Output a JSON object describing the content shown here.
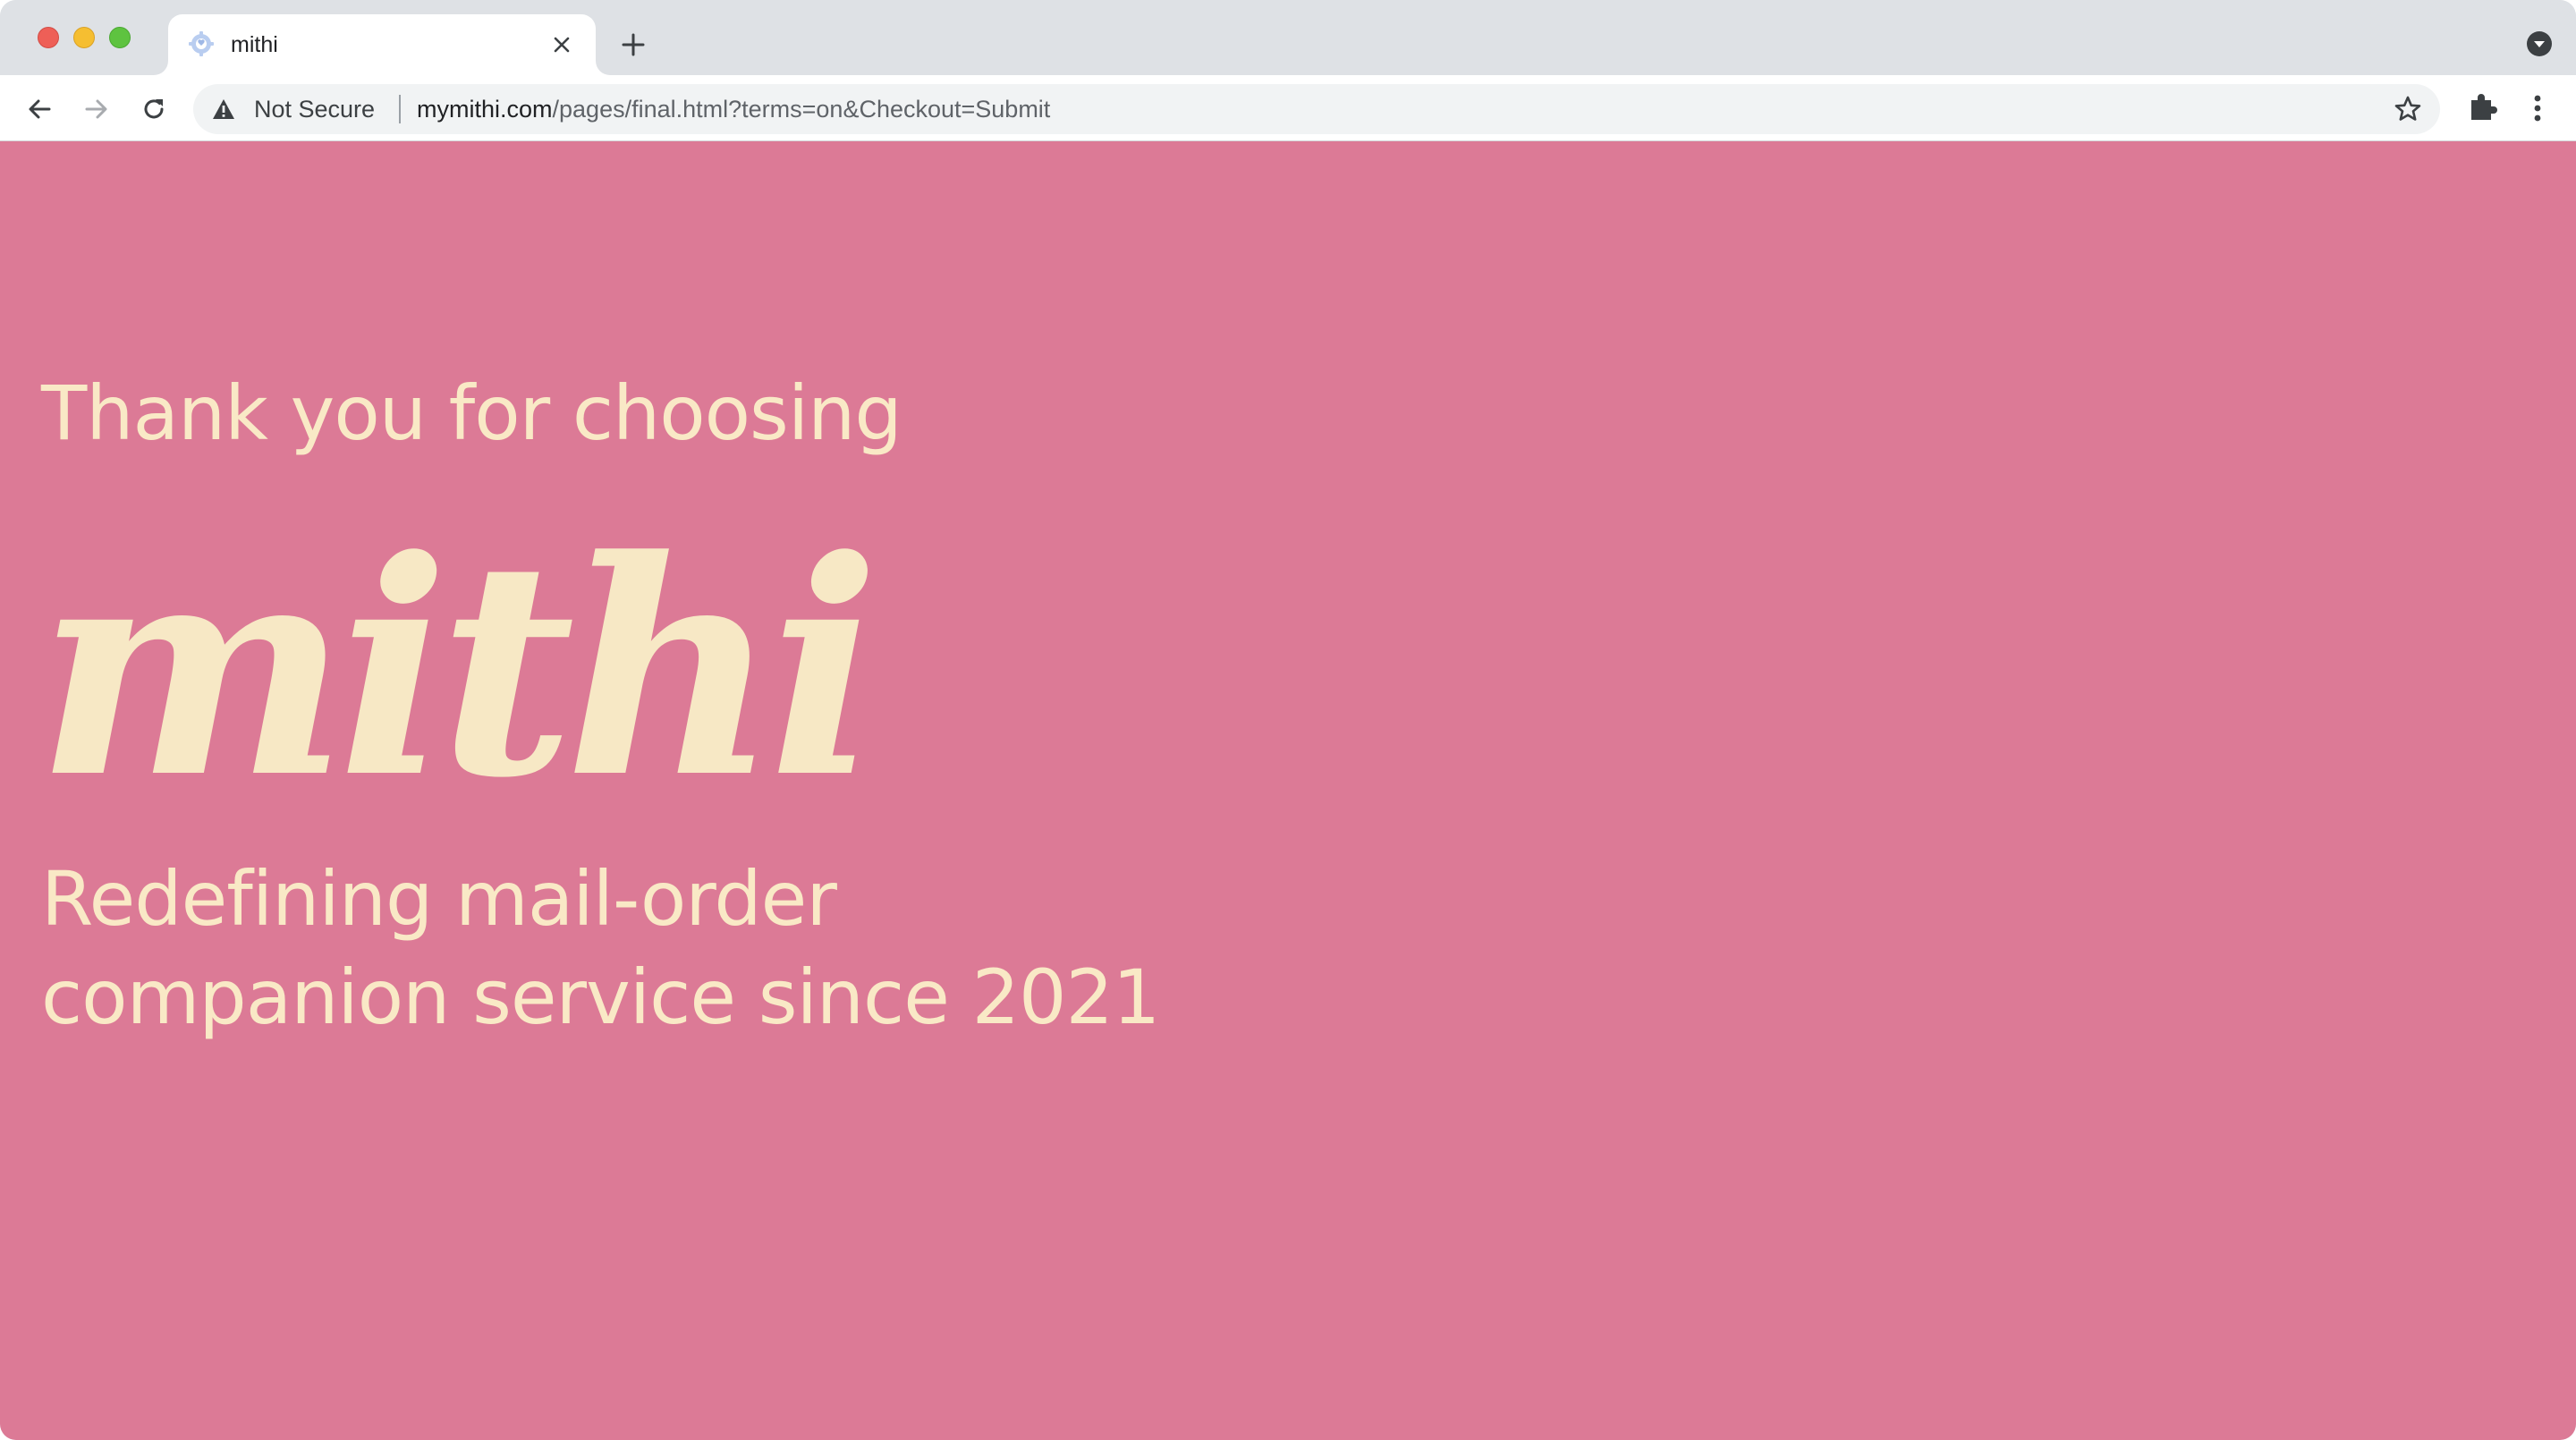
{
  "browser": {
    "tab": {
      "title": "mithi",
      "favicon": "gear-icon"
    },
    "omnibox": {
      "security_label": "Not Secure",
      "url_host": "mymithi.com",
      "url_path": "/pages/final.html?terms=on&Checkout=Submit"
    },
    "icons": {
      "back": "arrow-left-icon",
      "forward": "arrow-right-icon",
      "reload": "reload-icon",
      "warning": "warning-icon",
      "bookmark": "star-icon",
      "extensions": "puzzle-icon",
      "menu": "kebab-menu-icon",
      "new_tab": "plus-icon",
      "close_tab": "close-icon",
      "tab_search": "chevron-down-icon"
    }
  },
  "page": {
    "background_color": "#dc7a96",
    "text_color": "#f9e9c6",
    "headline": "Thank you for choosing",
    "logo_text": "mithi",
    "tagline_line1": "Redefining mail-order",
    "tagline_line2": "companion service since 2021"
  }
}
